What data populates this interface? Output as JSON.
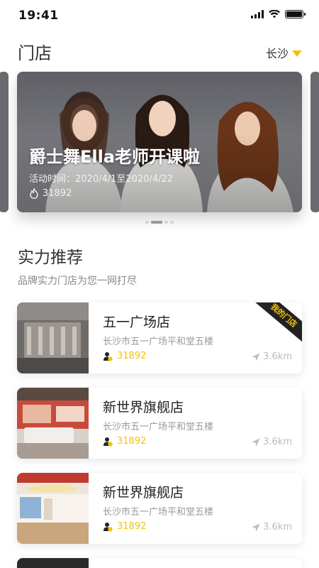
{
  "status_bar": {
    "time": "19:41"
  },
  "header": {
    "title": "门店",
    "city": "长沙"
  },
  "banner": {
    "title": "爵士舞Ella老师开课啦",
    "date_label": "活动时间：2020/4/1至2020/4/22",
    "hot_count": "31892",
    "slide_count": 4,
    "active_slide": 1
  },
  "section": {
    "title": "实力推荐",
    "subtitle": "品牌实力门店为您一网打尽"
  },
  "my_store_badge": "我的门店",
  "stores": [
    {
      "name": "五一广场店",
      "address": "长沙市五一广场平和堂五楼",
      "hot": "31892",
      "distance": "3.6km"
    },
    {
      "name": "新世界旗舰店",
      "address": "长沙市五一广场平和堂五楼",
      "hot": "31892",
      "distance": "3.6km"
    },
    {
      "name": "新世界旗舰店",
      "address": "长沙市五一广场平和堂五楼",
      "hot": "31892",
      "distance": "3.6km"
    }
  ],
  "colors": {
    "accent": "#f5c20b",
    "text": "#222222",
    "muted": "#999999"
  },
  "icons": [
    "signal-icon",
    "wifi-icon",
    "battery-icon",
    "dropdown-arrow-icon",
    "flame-icon",
    "user-badge-icon",
    "location-arrow-icon"
  ]
}
